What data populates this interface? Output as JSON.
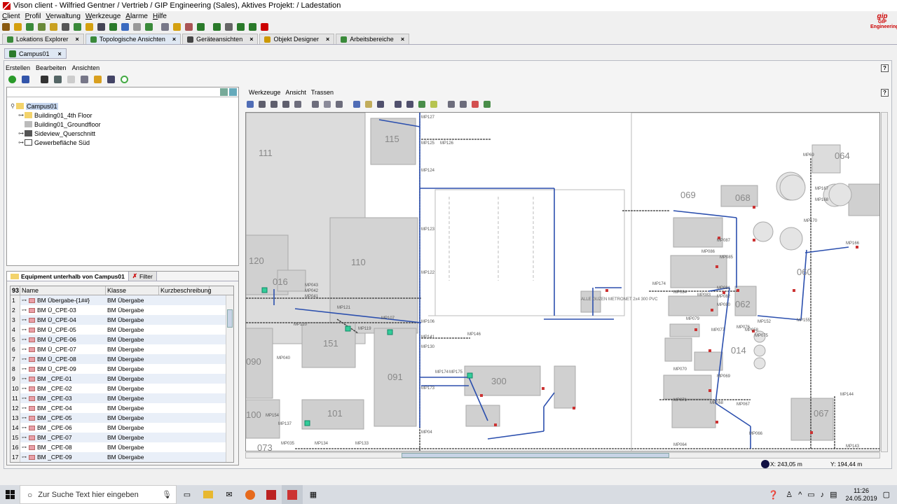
{
  "window": {
    "title": "Vison client - Wilfried Gentner / Vertrieb / GIP Engineering (Sales), Aktives Projekt: / Ladestation",
    "brand": "GIP Engineering"
  },
  "menu": [
    "Client",
    "Profil",
    "Verwaltung",
    "Werkzeuge",
    "Alarme",
    "Hilfe"
  ],
  "tabs": [
    {
      "label": "Lokations Explorer"
    },
    {
      "label": "Topologische Ansichten"
    },
    {
      "label": "Geräteansichten"
    },
    {
      "label": "Objekt Designer"
    },
    {
      "label": "Arbeitsbereiche"
    }
  ],
  "subtab": {
    "label": "Campus01"
  },
  "content_menu": [
    "Erstellen",
    "Bearbeiten",
    "Ansichten"
  ],
  "tree": {
    "root": "Campus01",
    "children": [
      "Building01_4th Floor",
      "Building01_Groundfloor",
      "Sideview_Querschnitt",
      "Gewerbefläche Süd"
    ]
  },
  "equipment": {
    "tab_label": "Equipment unterhalb von Campus01",
    "filter_label": "Filter",
    "count": "93",
    "headers": [
      "Name",
      "Klasse",
      "Kurzbeschreibung"
    ],
    "rows": [
      {
        "n": "1",
        "name": "BM Übergabe-{1##}",
        "cls": "BM Übergabe"
      },
      {
        "n": "2",
        "name": "BM Ü_CPE-03",
        "cls": "BM Übergabe"
      },
      {
        "n": "3",
        "name": "BM Ü_CPE-04",
        "cls": "BM Übergabe"
      },
      {
        "n": "4",
        "name": "BM Ü_CPE-05",
        "cls": "BM Übergabe"
      },
      {
        "n": "5",
        "name": "BM Ü_CPE-06",
        "cls": "BM Übergabe"
      },
      {
        "n": "6",
        "name": "BM Ü_CPE-07",
        "cls": "BM Übergabe"
      },
      {
        "n": "7",
        "name": "BM Ü_CPE-08",
        "cls": "BM Übergabe"
      },
      {
        "n": "8",
        "name": "BM Ü_CPE-09",
        "cls": "BM Übergabe"
      },
      {
        "n": "9",
        "name": "BM _CPE-01",
        "cls": "BM Übergabe"
      },
      {
        "n": "10",
        "name": "BM _CPE-02",
        "cls": "BM Übergabe"
      },
      {
        "n": "11",
        "name": "BM _CPE-03",
        "cls": "BM Übergabe"
      },
      {
        "n": "12",
        "name": "BM _CPE-04",
        "cls": "BM Übergabe"
      },
      {
        "n": "13",
        "name": "BM _CPE-05",
        "cls": "BM Übergabe"
      },
      {
        "n": "14",
        "name": "BM _CPE-06",
        "cls": "BM Übergabe"
      },
      {
        "n": "15",
        "name": "BM _CPE-07",
        "cls": "BM Übergabe"
      },
      {
        "n": "16",
        "name": "BM _CPE-08",
        "cls": "BM Übergabe"
      },
      {
        "n": "17",
        "name": "BM _CPE-09",
        "cls": "BM Übergabe"
      }
    ]
  },
  "map_menu": [
    "Werkzeuge",
    "Ansicht",
    "Trassen"
  ],
  "map": {
    "buildings": [
      "111",
      "115",
      "120",
      "110",
      "016",
      "151",
      "090",
      "091",
      "300",
      "100",
      "101",
      "073",
      "069",
      "068",
      "064",
      "060",
      "062",
      "014",
      "067"
    ],
    "points": [
      "MP127",
      "MP125",
      "MP126",
      "MP124",
      "MP123",
      "MP122",
      "MP121",
      "MP120",
      "MP119",
      "MP107",
      "MP106",
      "MP141",
      "MP146",
      "MP130",
      "MP174",
      "MP175",
      "MP173",
      "MP04",
      "MP133",
      "MP134",
      "MP035",
      "MP043",
      "MP042",
      "MP041",
      "MP040",
      "MP154",
      "MP137",
      "MP69",
      "MP167",
      "MP168",
      "MP166",
      "MP170",
      "MP174",
      "MP084",
      "MP083",
      "MP082",
      "MP080",
      "MP081",
      "MP087",
      "MP086",
      "MP085",
      "MP079",
      "MP076",
      "MP075",
      "MP058",
      "MP077",
      "MP070",
      "MP071",
      "MP068",
      "MP067",
      "MP066",
      "MP144",
      "MP143",
      "MP064",
      "MP152",
      "MP155",
      "MP069"
    ],
    "annotation": "ALLE GUZEN METRONET 2x4 300 PVC"
  },
  "status": {
    "x_label": "X:",
    "x_value": "243,05 m",
    "y_label": "Y:",
    "y_value": "194,44 m"
  },
  "taskbar": {
    "search_placeholder": "Zur Suche Text hier eingeben",
    "time": "11:26",
    "date": "24.05.2019"
  }
}
